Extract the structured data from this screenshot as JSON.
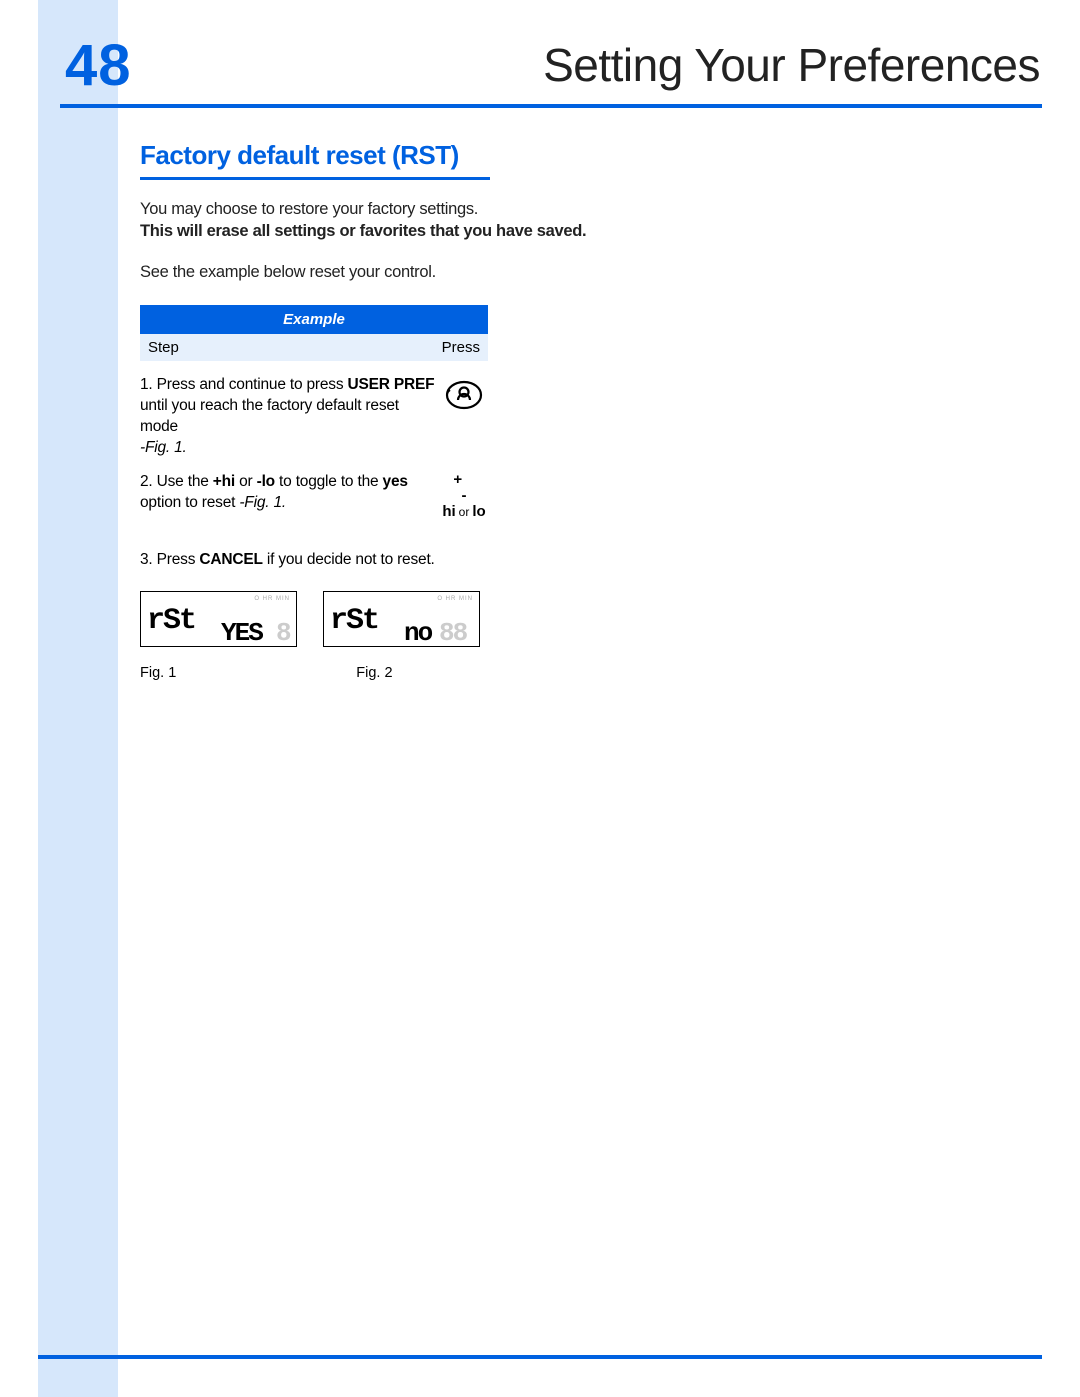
{
  "page_number": "48",
  "chapter_title": "Setting Your Preferences",
  "section_title": "Factory default reset (RST)",
  "intro_line1": "You may choose to restore your factory settings.",
  "intro_bold": "This will erase all settings or favorites that you have saved.",
  "intro_line2": "See the example below reset your control.",
  "table": {
    "header": "Example",
    "col1": "Step",
    "col2": "Press"
  },
  "steps": [
    {
      "num": "1.",
      "lead": " Press and continue to press ",
      "bold1": "USER PREF",
      "after1": " until you reach the factory default reset mode",
      "fig": " -Fig. 1."
    },
    {
      "num": "2.",
      "lead": " Use the ",
      "bold1": "+hi",
      "mid": " or ",
      "bold2": "-lo",
      "after": " to toggle to the ",
      "bold3": "yes",
      "tail": " option to reset ",
      "fig": " -Fig. 1."
    },
    {
      "num": "3.",
      "lead": " Press ",
      "bold1": "CANCEL",
      "after": " if you decide not to reset."
    }
  ],
  "hilo": {
    "plus": "+",
    "minus": "-",
    "hi": "hi",
    "or": "or",
    "lo": "lo"
  },
  "display1": {
    "code": "rSt",
    "value": "YES",
    "ghost": "8",
    "tiny": "O   HR   MIN"
  },
  "display2": {
    "code": "rSt",
    "value": "no",
    "ghost": "88",
    "tiny": "O   HR   MIN"
  },
  "fig1_label": "Fig. 1",
  "fig2_label": "Fig. 2"
}
